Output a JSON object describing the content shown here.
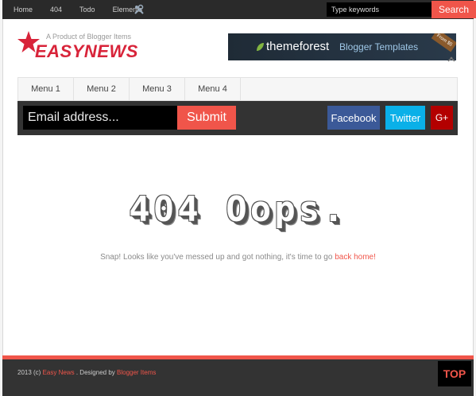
{
  "topbar": {
    "nav": [
      "Home",
      "404",
      "Todo",
      "Elements"
    ],
    "search_placeholder": "Type keywords",
    "search_button": "Search"
  },
  "header": {
    "tagline": "A Product of Blogger Items",
    "logo": "EASYNEWS",
    "banner": {
      "brand": "themeforest",
      "text": "Blogger Templates",
      "tag": "From $5"
    }
  },
  "menu": [
    "Menu 1",
    "Menu 2",
    "Menu 3",
    "Menu 4"
  ],
  "subscribe": {
    "email_placeholder": "Email address...",
    "submit": "Submit",
    "facebook": "Facebook",
    "twitter": "Twitter",
    "gplus": "G+"
  },
  "error": {
    "heading": "404 Oops.",
    "message": "Snap! Looks like you've messed up and got nothing, it's time to go",
    "link": "back home!"
  },
  "footer": {
    "copyright": "2013 (c)",
    "site": "Easy News",
    "designed": ". Designed by",
    "designer": "Blogger Items",
    "top": "TOP"
  },
  "colors": {
    "accent": "#f0554a",
    "dark": "#333333",
    "logo": "#d8243a",
    "facebook": "#3b5998",
    "twitter": "#0ab0e8",
    "gplus": "#b30000"
  }
}
